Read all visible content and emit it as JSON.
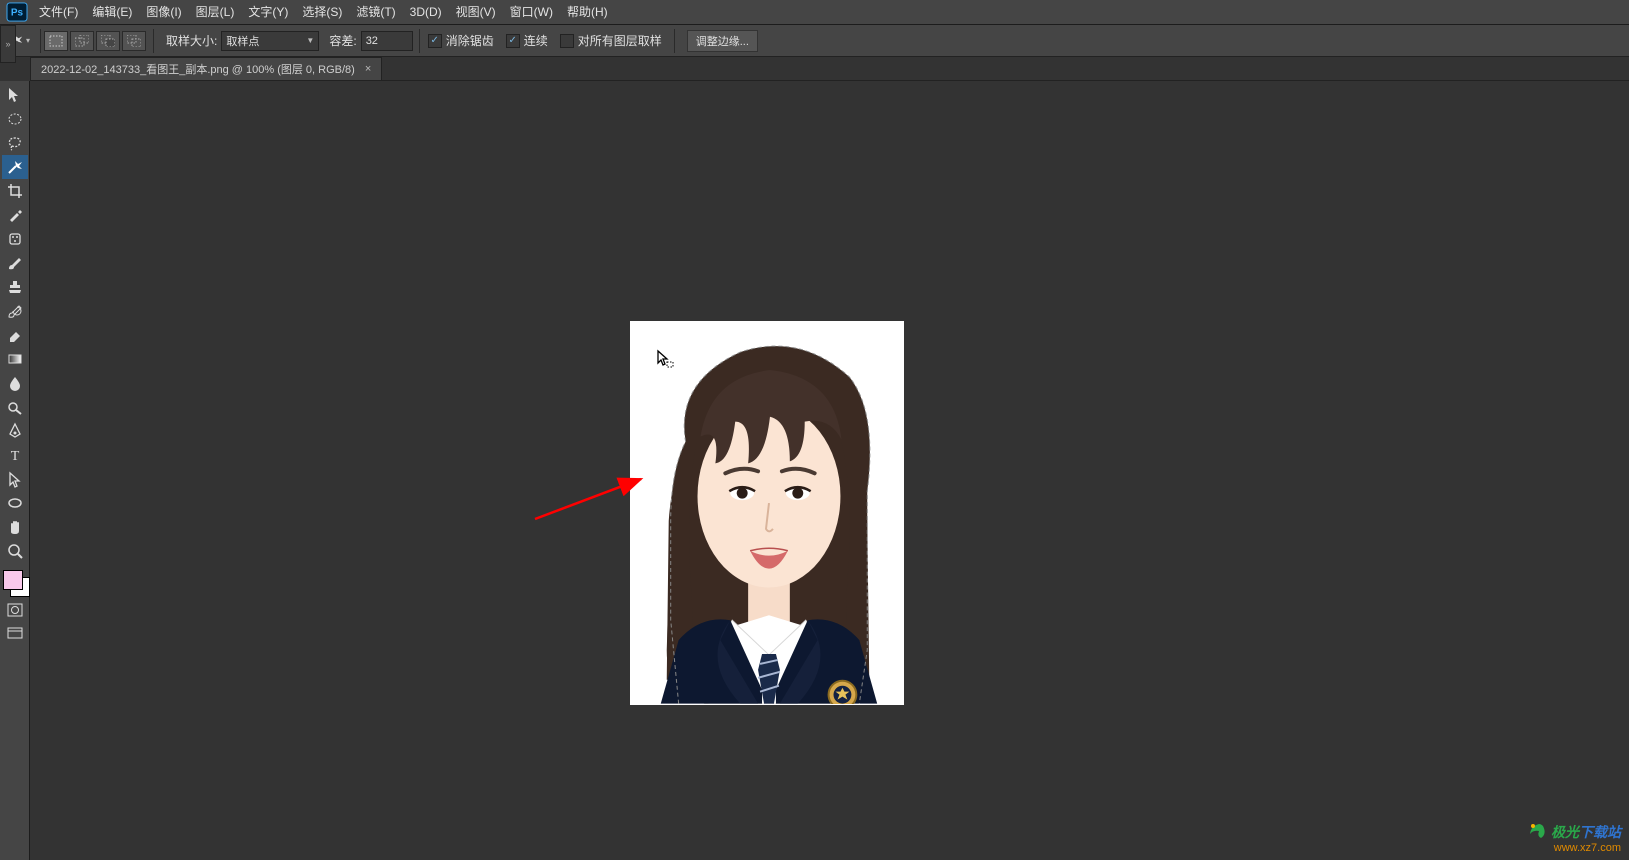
{
  "menubar": {
    "items": [
      "文件(F)",
      "编辑(E)",
      "图像(I)",
      "图层(L)",
      "文字(Y)",
      "选择(S)",
      "滤镜(T)",
      "3D(D)",
      "视图(V)",
      "窗口(W)",
      "帮助(H)"
    ]
  },
  "options_bar": {
    "sample_size_label": "取样大小:",
    "sample_size_value": "取样点",
    "tolerance_label": "容差:",
    "tolerance_value": "32",
    "antialias_label": "消除锯齿",
    "antialias_checked": true,
    "contiguous_label": "连续",
    "contiguous_checked": true,
    "all_layers_label": "对所有图层取样",
    "all_layers_checked": false,
    "refine_edge_label": "调整边缘..."
  },
  "doc_tab": {
    "title": "2022-12-02_143733_看图王_副本.png @ 100% (图层 0, RGB/8)",
    "close": "×"
  },
  "tools": [
    {
      "name": "move-tool"
    },
    {
      "name": "marquee-tool"
    },
    {
      "name": "lasso-tool"
    },
    {
      "name": "magic-wand-tool",
      "active": true
    },
    {
      "name": "crop-tool"
    },
    {
      "name": "eyedropper-tool"
    },
    {
      "name": "healing-brush-tool"
    },
    {
      "name": "brush-tool"
    },
    {
      "name": "clone-stamp-tool"
    },
    {
      "name": "history-brush-tool"
    },
    {
      "name": "eraser-tool"
    },
    {
      "name": "gradient-tool"
    },
    {
      "name": "blur-tool"
    },
    {
      "name": "dodge-tool"
    },
    {
      "name": "pen-tool"
    },
    {
      "name": "type-tool"
    },
    {
      "name": "path-selection-tool"
    },
    {
      "name": "shape-tool"
    },
    {
      "name": "hand-tool"
    },
    {
      "name": "zoom-tool"
    }
  ],
  "colors": {
    "foreground": "#f9c9eb",
    "background": "#ffffff"
  },
  "watermark": {
    "line1_a": "极光",
    "line1_b": "下载站",
    "line2": "www.xz7.com"
  },
  "panel_toggle": "»"
}
